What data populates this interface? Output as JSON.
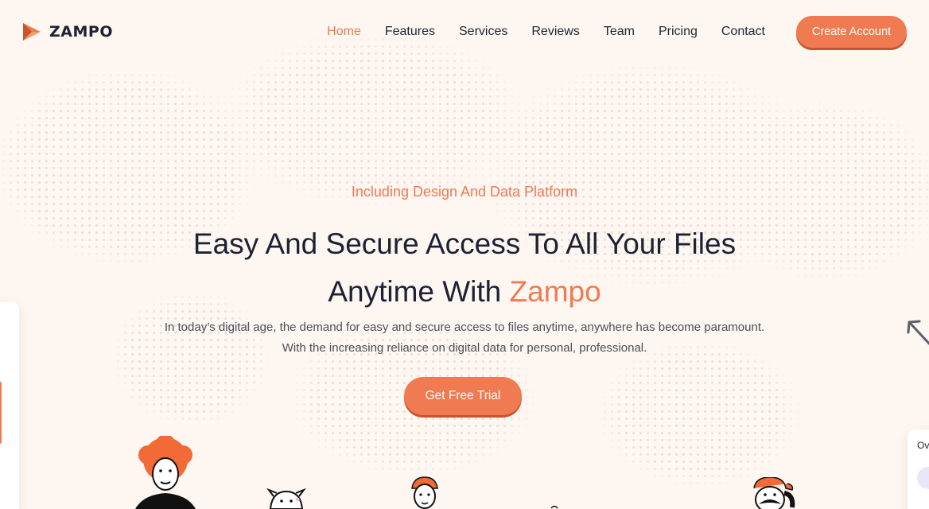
{
  "brand": {
    "name": "ZAMPO",
    "icon": "play-logo-icon",
    "accent_color": "#f07a52"
  },
  "nav": {
    "items": [
      {
        "label": "Home",
        "active": true
      },
      {
        "label": "Features",
        "active": false
      },
      {
        "label": "Services",
        "active": false
      },
      {
        "label": "Reviews",
        "active": false
      },
      {
        "label": "Team",
        "active": false
      },
      {
        "label": "Pricing",
        "active": false
      },
      {
        "label": "Contact",
        "active": false
      }
    ],
    "cta_label": "Create Account"
  },
  "hero": {
    "eyebrow": "Including Design And Data Platform",
    "headline_prefix": "Easy And Secure Access To All Your Files Anytime With ",
    "headline_accent": "Zampo",
    "subtext": "In today’s digital age, the demand for easy and secure access to files anytime, anywhere has become paramount. With the increasing reliance on digital data for personal, professional.",
    "cta_label": "Get Free Trial"
  },
  "side_widgets": {
    "right_card_label": "Ov"
  }
}
